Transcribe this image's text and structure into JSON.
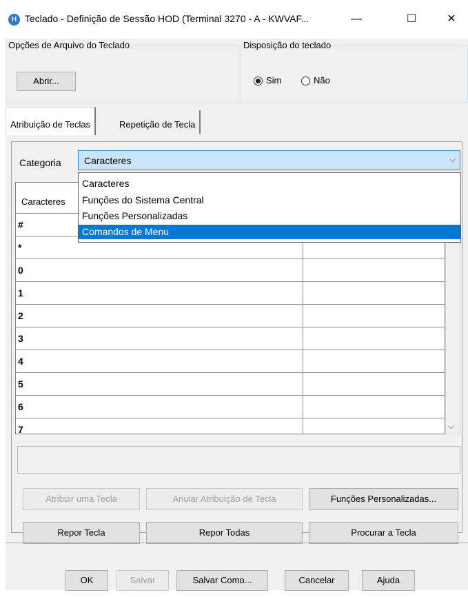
{
  "window": {
    "app_icon_letter": "H",
    "title": "Teclado - Definição de Sessão HOD (Terminal 3270 - A - KWVAF...",
    "minimize_glyph": "—",
    "maximize_glyph": "☐",
    "close_glyph": "✕"
  },
  "file_options": {
    "legend": "Opções de Arquivo do Teclado",
    "open_button": "Abrir..."
  },
  "layout_group": {
    "legend": "Disposição do teclado",
    "options": [
      "Sim",
      "Não"
    ],
    "selected": "Sim"
  },
  "tabs": [
    {
      "label": "Atribuição de Teclas",
      "active": true
    },
    {
      "label": "Repetição de Tecla",
      "active": false
    }
  ],
  "category": {
    "label": "Categoria",
    "value": "Caracteres",
    "arrow": "⌵",
    "options": [
      "Caracteres",
      "Funções do Sistema Central",
      "Funções Personalizadas",
      "Comandos de Menu"
    ],
    "highlighted": "Comandos de Menu"
  },
  "table": {
    "header": "Caracteres",
    "rows": [
      "#",
      "*",
      "0",
      "1",
      "2",
      "3",
      "4",
      "5",
      "6",
      "7"
    ]
  },
  "scrollbar": {
    "down_arrow": "⌵"
  },
  "actions": {
    "assign": "Atribuir uma Tecla",
    "unassign": "Anular Atribuição de Tecla",
    "custom_functions": "Funções Personalizadas...",
    "reset_key": "Repor Tecla",
    "reset_all": "Repor Todas",
    "find_key": "Procurar a Tecla"
  },
  "footer": {
    "ok": "OK",
    "save": "Salvar",
    "save_as": "Salvar Como...",
    "cancel": "Cancelar",
    "help": "Ajuda"
  }
}
